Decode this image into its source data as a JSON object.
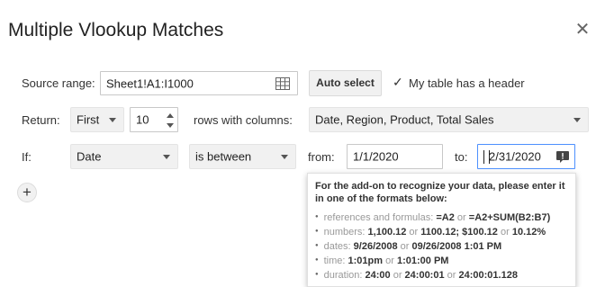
{
  "dialog": {
    "title": "Multiple Vlookup Matches"
  },
  "source": {
    "label": "Source range:",
    "value": "Sheet1!A1:I1000",
    "auto_select": "Auto select",
    "header_checkbox_label": "My table has a header",
    "header_checked": true
  },
  "return": {
    "label": "Return:",
    "mode": "First",
    "count": "10",
    "columns_label": "rows with columns:",
    "columns_value": "Date, Region, Product, Total Sales"
  },
  "condition": {
    "label": "If:",
    "column": "Date",
    "operator": "is between",
    "from_label": "from:",
    "from_value": "1/1/2020",
    "to_label": "to:",
    "to_value": "2/31/2020"
  },
  "add_condition": "+",
  "tooltip": {
    "heading": "For the add-on to recognize your data, please enter it in one of the formats below:",
    "items": [
      {
        "label": "references and formulas:",
        "parts": [
          "=A2",
          " or ",
          "=A2+SUM(B2:B7)"
        ]
      },
      {
        "label": "numbers:",
        "parts": [
          "1,100.12",
          " or ",
          "1100.12; $100.12",
          " or ",
          "10.12%"
        ]
      },
      {
        "label": "dates:",
        "parts": [
          "9/26/2008",
          " or ",
          "09/26/2008 1:01 PM"
        ]
      },
      {
        "label": "time:",
        "parts": [
          "1:01pm",
          " or ",
          "1:01:00 PM"
        ]
      },
      {
        "label": "duration:",
        "parts": [
          "24:00",
          " or ",
          "24:00:01",
          " or ",
          "24:00:01.128"
        ]
      }
    ]
  },
  "icons": {
    "grid": "table-grid-icon",
    "close": "close-icon",
    "hint": "comment-hint-icon",
    "checkbox": "checkmark-icon"
  }
}
